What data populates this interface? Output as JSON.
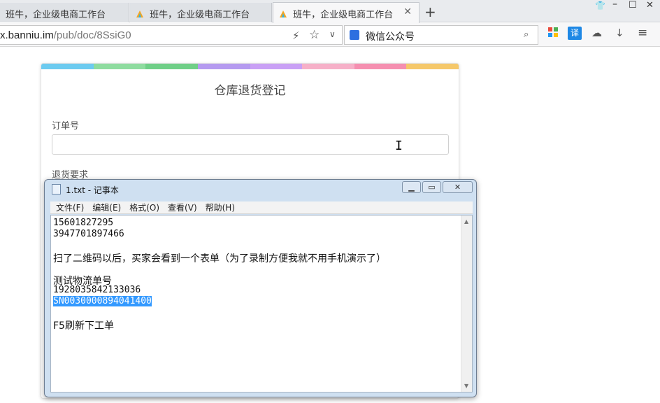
{
  "browser": {
    "tabs": [
      {
        "label": "班牛，企业级电商工作台"
      },
      {
        "label": "班牛，企业级电商工作台"
      },
      {
        "label": "班牛，企业级电商工作台",
        "active": true
      }
    ],
    "new_tab_icon": "plus-icon",
    "url_host": "x.banniu.im",
    "url_path": "/pub/doc/8SsiG0",
    "search_text": "微信公众号",
    "colors": {
      "tab_active": "#f7f7f8",
      "tab_inactive": "#dfe2e6",
      "translate_icon": "#1e88e5"
    }
  },
  "form": {
    "title": "仓库退货登记",
    "fields": [
      {
        "label": "订单号",
        "value": ""
      },
      {
        "label": "退货要求"
      }
    ],
    "stripe_colors": [
      "#6ccbf0",
      "#8edc9f",
      "#6fcf87",
      "#b59af0",
      "#c9a0f5",
      "#f6b0c8",
      "#f58fb0",
      "#f5c86a"
    ]
  },
  "notepad": {
    "title": "1.txt - 记事本",
    "menu": [
      "文件(F)",
      "编辑(E)",
      "格式(O)",
      "查看(V)",
      "帮助(H)"
    ],
    "lines": [
      "15601827295",
      "3947701897466",
      "",
      "扫了二维码以后，买家会看到一个表单（为了录制方便我就不用手机演示了）",
      "",
      "测试物流单号",
      "1928035842133036",
      "SN0030000894041400",
      "",
      "F5刷新下工单"
    ],
    "selected_line": "SN0030000894041400",
    "selection_color": "#3399ff"
  }
}
